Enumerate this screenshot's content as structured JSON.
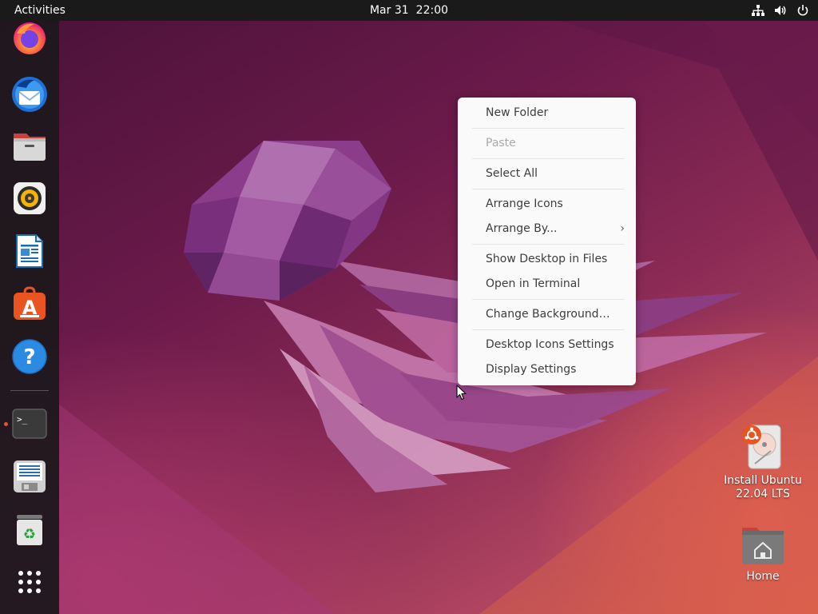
{
  "topbar": {
    "activities_label": "Activities",
    "date": "Mar 31",
    "time": "22:00",
    "tray_icons": [
      "network-icon",
      "volume-icon",
      "power-icon"
    ]
  },
  "dock": {
    "apps": [
      {
        "name": "Firefox",
        "icon": "firefox-icon"
      },
      {
        "name": "Thunderbird Mail",
        "icon": "thunderbird-icon"
      },
      {
        "name": "Files",
        "icon": "files-icon"
      },
      {
        "name": "Rhythmbox",
        "icon": "rhythmbox-icon"
      },
      {
        "name": "LibreOffice Writer",
        "icon": "writer-icon"
      },
      {
        "name": "Ubuntu Software",
        "icon": "software-icon"
      },
      {
        "name": "Help",
        "icon": "help-icon"
      },
      {
        "name": "Terminal",
        "icon": "terminal-icon"
      },
      {
        "name": "Text Editor",
        "icon": "text-editor-icon"
      },
      {
        "name": "Trash",
        "icon": "trash-icon"
      },
      {
        "name": "Show Applications",
        "icon": "app-grid-icon"
      }
    ],
    "running_app": "Terminal"
  },
  "desktop": {
    "icons": [
      {
        "label_line1": "Install Ubuntu",
        "label_line2": "22.04 LTS",
        "icon": "install-ubuntu-icon"
      },
      {
        "label": "Home",
        "icon": "home-folder-icon"
      }
    ]
  },
  "context_menu": {
    "items": [
      {
        "label": "New Folder",
        "enabled": true
      },
      {
        "label": "Paste",
        "enabled": false
      },
      {
        "label": "Select All",
        "enabled": true
      },
      {
        "label": "Arrange Icons",
        "enabled": true
      },
      {
        "label": "Arrange By...",
        "enabled": true,
        "submenu_glyph": "›"
      },
      {
        "label": "Show Desktop in Files",
        "enabled": true
      },
      {
        "label": "Open in Terminal",
        "enabled": true
      },
      {
        "label": "Change Background…",
        "enabled": true
      },
      {
        "label": "Desktop Icons Settings",
        "enabled": true
      },
      {
        "label": "Display Settings",
        "enabled": true
      }
    ]
  },
  "colors": {
    "topbar_bg": "#1a1a1a",
    "dock_bg": "#1e181c",
    "accent": "#e95420",
    "menu_bg": "#fafafa",
    "menu_text": "#3d3d3d",
    "menu_disabled": "#a8a8a8"
  }
}
